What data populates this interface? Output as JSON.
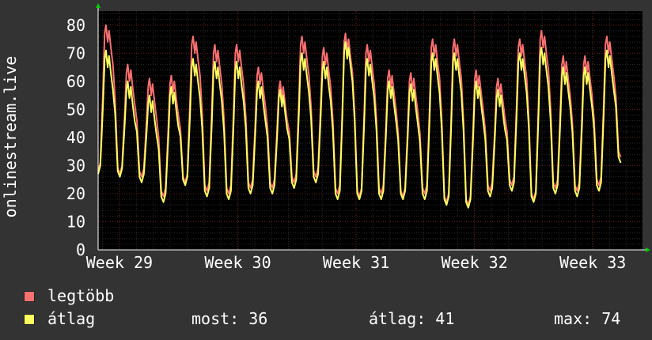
{
  "chart_data": {
    "type": "line",
    "ylabel": "onlinestream.live",
    "ylim": [
      0,
      85
    ],
    "yticks": [
      0,
      10,
      20,
      30,
      40,
      50,
      60,
      70,
      80
    ],
    "xticks": [
      "Week 29",
      "Week 30",
      "Week 31",
      "Week 32",
      "Week 33"
    ],
    "x_range_weeks": [
      28.82,
      33.42
    ],
    "grid": true,
    "legend_position": "bottom-left",
    "colors": {
      "background": "#333333",
      "canvas": "#000000",
      "grid_minor": "#2a2a2a",
      "grid_major": "#6e2020",
      "axis": "#ffffff",
      "arrow": "#00cc00"
    },
    "series": [
      {
        "name": "legtöbb",
        "color": "#ff7070",
        "peaks": [
          80,
          66,
          61,
          62,
          76,
          73,
          73,
          65,
          60,
          76,
          72,
          77,
          73,
          64,
          63,
          75,
          75,
          64,
          61,
          75,
          78,
          69,
          69,
          76,
          68
        ],
        "troughs": [
          27,
          26,
          19,
          24,
          21,
          20,
          22,
          22,
          24,
          26,
          20,
          19,
          20,
          19,
          20,
          17,
          16,
          21,
          23,
          18,
          22,
          21,
          23
        ]
      },
      {
        "name": "átlag",
        "color": "#ffff60",
        "peaks": [
          71,
          60,
          55,
          58,
          68,
          67,
          67,
          60,
          57,
          70,
          67,
          74,
          68,
          60,
          59,
          70,
          70,
          60,
          57,
          70,
          72,
          65,
          65,
          71,
          63
        ],
        "troughs": [
          26,
          24,
          17,
          23,
          19,
          18,
          20,
          20,
          22,
          24,
          18,
          18,
          18,
          18,
          18,
          16,
          15,
          19,
          21,
          17,
          20,
          19,
          21
        ]
      }
    ]
  },
  "legend": {
    "items": [
      {
        "label": "legtöbb",
        "color": "#ff7070"
      },
      {
        "label": "átlag",
        "color": "#ffff60"
      }
    ],
    "stats": {
      "now": "most: 36",
      "avg": "átlag: 41",
      "max": "max: 74"
    }
  }
}
